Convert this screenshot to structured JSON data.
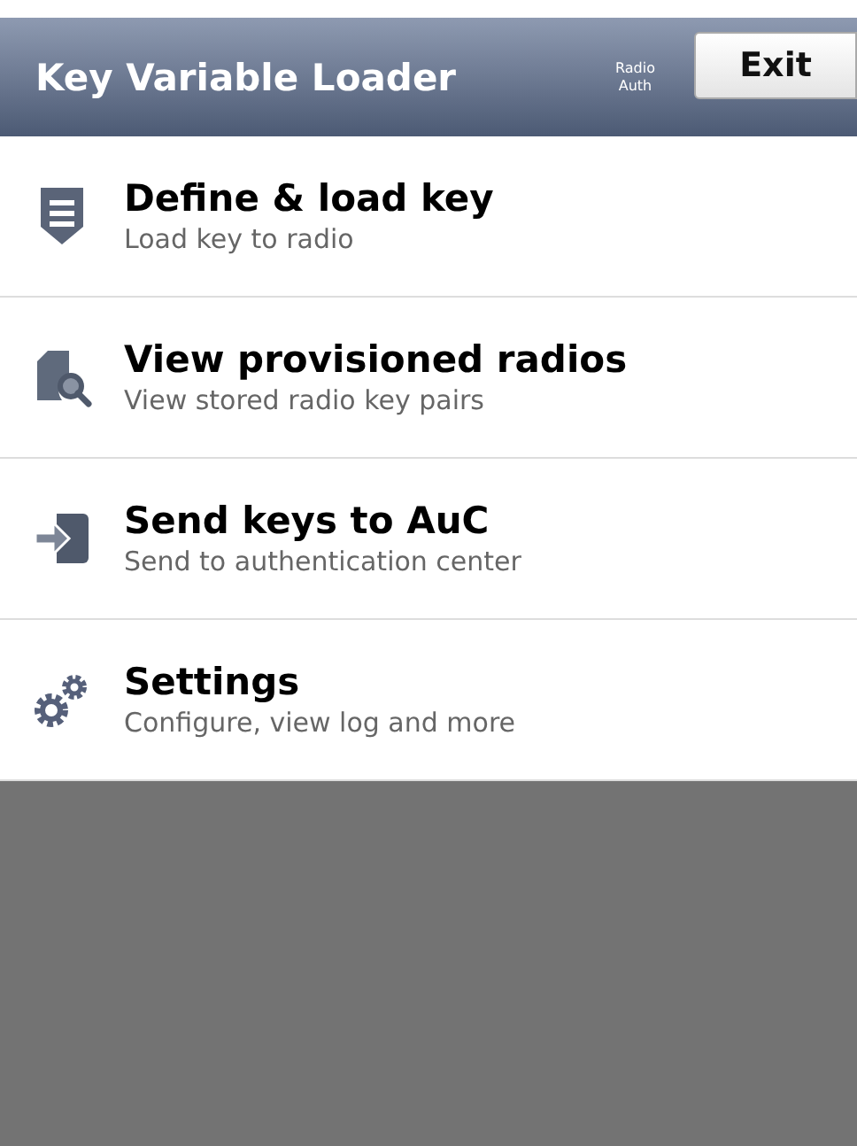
{
  "header": {
    "title": "Key Variable Loader",
    "status_lines": [
      "Radio",
      "Auth"
    ],
    "exit_button": "Exit"
  },
  "menu": [
    {
      "kind": "shield",
      "title": "Define & load key",
      "subtitle": "Load key to radio"
    },
    {
      "kind": "search",
      "title": "View provisioned radios",
      "subtitle": "View stored radio key pairs"
    },
    {
      "kind": "send",
      "title": "Send keys to AuC",
      "subtitle": "Send to authentication center"
    },
    {
      "kind": "gears",
      "title": "Settings",
      "subtitle": "Configure, view log and more"
    }
  ]
}
